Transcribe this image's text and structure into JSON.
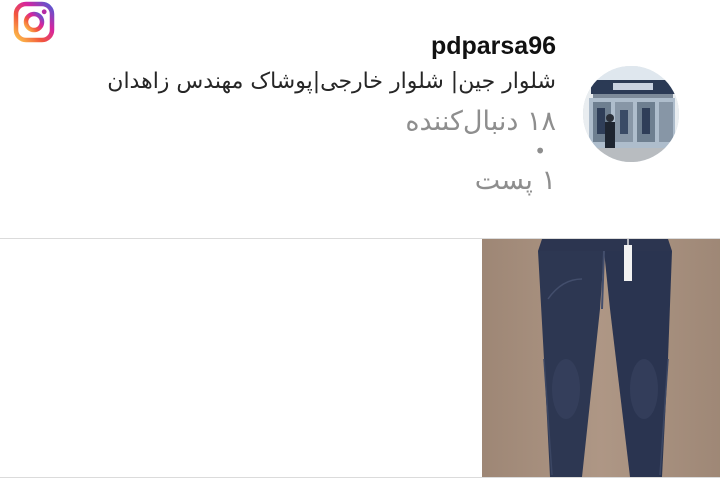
{
  "app": {
    "logo_icon": "instagram-logo-icon"
  },
  "profile": {
    "username": "pdparsa96",
    "full_name": "شلوار جین| شلوار خارجی|پوشاک مهندس زاهدان",
    "followers_text": "۱۸ دنبال‌کننده",
    "separator": "•",
    "posts_text": "۱ پست",
    "avatar_icon": "profile-avatar"
  },
  "posts": [
    {
      "thumbnail_icon": "jeans-photo"
    }
  ],
  "colors": {
    "text_primary": "#262626",
    "text_secondary": "#8e8e8e",
    "divider": "#dbdbdb",
    "background": "#ffffff"
  }
}
